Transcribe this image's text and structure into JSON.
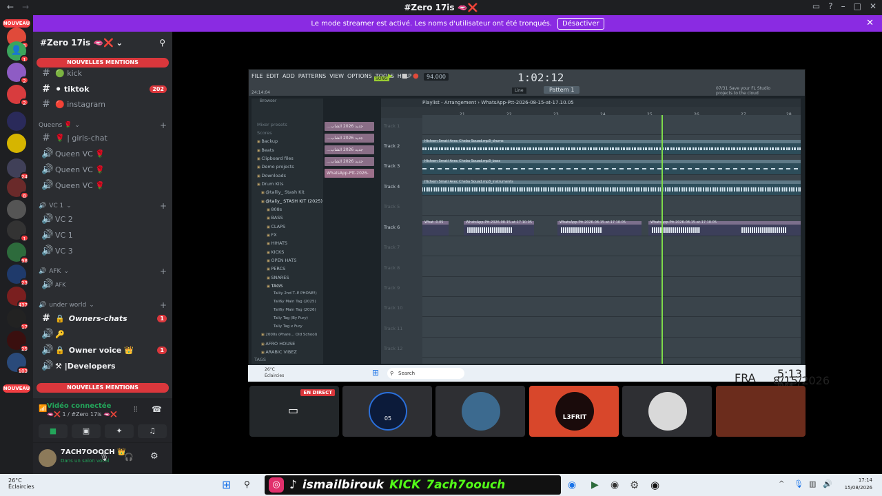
{
  "window": {
    "title": "#Zero 17is 🫦❌",
    "back": "←",
    "forward": "→"
  },
  "banner": {
    "text": "Le mode streamer est activé. Les noms d'utilisateur ont été tronqués.",
    "button": "Désactiver"
  },
  "servers": {
    "nouveau_top": "NOUVEAU",
    "nouveau_bottom": "NOUVEAU",
    "badges": [
      "3",
      "1",
      "2",
      "2",
      "24",
      "8",
      "1",
      "98",
      "23",
      "437",
      "17",
      "25",
      "103"
    ]
  },
  "guild": {
    "name": "#Zero 17is 🫦❌",
    "mentions_top": "NOUVELLES MENTIONS",
    "mentions_bottom": "NOUVELLES MENTIONS",
    "channels": [
      {
        "name": "🟢 kick",
        "count": ""
      },
      {
        "name": "⚫ tiktok",
        "count": "202"
      },
      {
        "name": "🔴 instagram",
        "count": ""
      }
    ],
    "queens_category": "Queens 🌹",
    "girls_chat": "🌹 | girls-chat",
    "queen_vcs": [
      "Queen VC 🌹",
      "Queen VC 🌹",
      "Queen VC 🌹"
    ],
    "vc_category": "VC 1",
    "vcs": [
      "VC 2",
      "VC 1",
      "VC 3"
    ],
    "afk_category": "AFK",
    "afk_channel": "AFK",
    "underworld_category": "under world",
    "owners_chats": "Owners-chats",
    "owners_count": "1",
    "key_channel": "🔑",
    "owner_voice": "Owner voice 👑",
    "owner_voice_count": "1",
    "developers": "⚒ |Developers"
  },
  "voice": {
    "status": "Vidéo connectée",
    "location": "🫦❌ 1 / #Zero 17is 🫦❌"
  },
  "user": {
    "name": "7ACH7OOOCH 👑",
    "status": "Dans un salon vocal"
  },
  "fl_studio": {
    "menus": [
      "FILE",
      "EDIT",
      "ADD",
      "PATTERNS",
      "VIEW",
      "OPTIONS",
      "TOOLS",
      "HELP"
    ],
    "song_label": "SONG",
    "tempo": "94.000",
    "time": "1:02:12",
    "counter": "24:14:04",
    "line_mode": "Line",
    "pattern": "Pattern 1",
    "cloud_hint": "07/31 Save your FL Studio projects to the cloud",
    "browser_title": "Browser",
    "browser_items": [
      "Mixer presets",
      "Scores",
      "Backup",
      "Beats",
      "Clipboard files",
      "Demo projects",
      "Downloads",
      "Drum Kits",
      "@talliy_ Stash Kit",
      "@taliy_ STASH KIT (2025)",
      "808s",
      "BASS",
      "CLAPS",
      "FX",
      "HIHATS",
      "KICKS",
      "OPEN HATS",
      "PERCS",
      "SNARES",
      "TAGS",
      "Taliiy 2nd T..E PHONE!)",
      "Tali6y Main Tag (2025)",
      "Tali6y Main Tag (2026)",
      "Taliy Tag (By Fury)",
      "Taliy Tag x Fury",
      "2000s (Phare... Old School)",
      "AFRO HOUSE",
      "ARABIC VIBEZ"
    ],
    "tags_footer": "TAGS",
    "patterns": [
      "...جديد 2026 الشاب",
      "...جديد 2026 الشاب",
      "...جديد 2026 الشاب",
      "...جديد 2026 الشاب",
      "WhatsApp-Ptt-2026-"
    ],
    "playlist_title": "Playlist - Arrangement › WhatsApp-Ptt-2026-08-15-at-17.10.05",
    "bar_numbers": [
      "21",
      "22",
      "23",
      "24",
      "25",
      "26",
      "27",
      "28"
    ],
    "tracks": [
      "Track 1",
      "Track 2",
      "Track 3",
      "Track 4",
      "Track 5",
      "Track 6",
      "Track 7",
      "Track 8",
      "Track 9",
      "Track 10",
      "Track 11",
      "Track 12"
    ],
    "clips": {
      "drums": "Hichem Smati Avec Cheba Souad.mp3_drums",
      "bass": "Hichem Smati Avec Cheba Souad.mp3_bass",
      "instruments": "Hichem Smati Avec Cheba Souad.mp3_instruments",
      "ptt_short": "What..0.05",
      "ptt": "WhatsApp-Ptt-2026-08-15-at-17.10.05"
    }
  },
  "inner_taskbar": {
    "temp": "26°C",
    "weather": "Éclaircies",
    "search": "Search",
    "lang": "FRA",
    "time": "5:13 PM",
    "date": "8/15/2026"
  },
  "tiles": {
    "live_label": "EN DIRECT",
    "names": [
      "05",
      "L3FRIT"
    ]
  },
  "taskbar": {
    "temp": "26°C",
    "weather": "Éclaircies",
    "handle": "ismailbirouk",
    "kick": "KICK",
    "kick_handle": "7ach7oouch",
    "time": "17:14",
    "date": "15/08/2026"
  }
}
